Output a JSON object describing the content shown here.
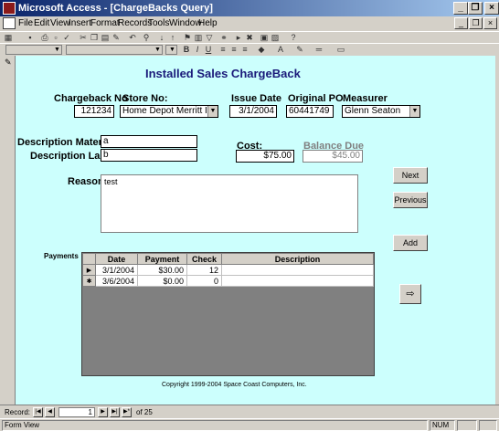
{
  "window": {
    "title": "Microsoft Access - [ChargeBacks Query]",
    "minimize": "_",
    "restore": "❐",
    "close": "×"
  },
  "menu": {
    "items": [
      "File",
      "Edit",
      "View",
      "Insert",
      "Format",
      "Records",
      "Tools",
      "Window",
      "Help"
    ],
    "mdi_minimize": "_",
    "mdi_restore": "❐",
    "mdi_close": "×"
  },
  "toolbar": {
    "font_size_dropdown": "",
    "font_name_dropdown": ""
  },
  "form": {
    "title": "Installed Sales ChargeBack",
    "labels": {
      "chargeback_no": "Chargeback No",
      "store_no": "Store No:",
      "issue_date": "Issue Date",
      "original_po": "Original PO",
      "measurer": "Measurer",
      "description_materials": "Description Materials",
      "description_labor": "Description Labor",
      "cost": "Cost:",
      "balance_due": "Balance Due",
      "reason": "Reason",
      "payments": "Payments"
    },
    "values": {
      "chargeback_no": "121234",
      "store_no": "Home Depot Merritt Isla",
      "issue_date": "3/1/2004",
      "original_po": "60441749",
      "measurer": "Glenn Seaton",
      "description_materials": "a",
      "description_labor": "b",
      "cost": "$75.00",
      "balance_due": "$45.00",
      "reason": "test"
    },
    "buttons": {
      "next": "Next",
      "previous": "Previous",
      "add": "Add",
      "exit_icon": "exit-door-icon"
    },
    "payments_table": {
      "headers": [
        "Date",
        "Payment",
        "Check",
        "Description"
      ],
      "rows": [
        {
          "selector": "▶",
          "date": "3/1/2004",
          "payment": "$30.00",
          "check": "12",
          "description": ""
        },
        {
          "selector": "✱",
          "date": "3/6/2004",
          "payment": "$0.00",
          "check": "0",
          "description": ""
        }
      ]
    },
    "copyright": "Copyright 1999-2004 Space Coast Computers, Inc."
  },
  "navigation": {
    "record_label": "Record:",
    "current_record": "1",
    "of_label": "of 25",
    "first": "|◀",
    "prev": "◀",
    "next": "▶",
    "last": "▶|",
    "new": "▶*"
  },
  "status": {
    "view": "Form View",
    "num": "NUM"
  },
  "colors": {
    "form_background": "#ccfffd",
    "title_color": "#1a1a7a",
    "titlebar_start": "#0a246a",
    "titlebar_end": "#a6caf0"
  }
}
